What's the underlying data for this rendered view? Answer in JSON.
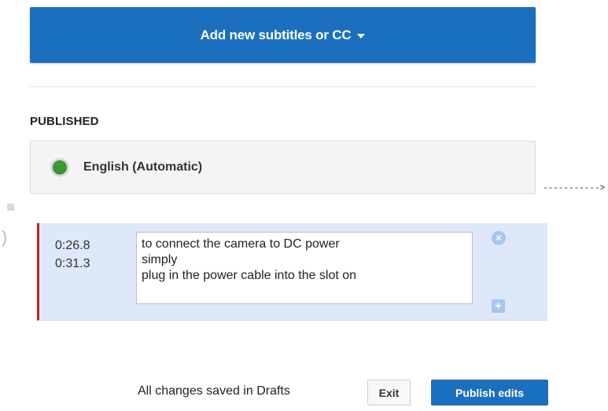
{
  "header": {
    "add_subtitles_label": "Add new subtitles or CC"
  },
  "published": {
    "section_title": "PUBLISHED",
    "language_label": "English (Automatic)",
    "status_color": "#3c9a32"
  },
  "annotation": {
    "arrow_text": "----------->"
  },
  "caption": {
    "start_time": "0:26.8",
    "end_time": "0:31.3",
    "text": "to connect the camera to DC power\nsimply\nplug in the power cable into the slot on",
    "remove_icon": "close-circle-icon",
    "add_icon": "plus-icon"
  },
  "footer": {
    "save_status": "All changes saved in Drafts",
    "exit_label": "Exit",
    "publish_label": "Publish edits"
  },
  "colors": {
    "accent": "#1b6fbf",
    "selected_row": "#dde9fa",
    "active_marker": "#cc1f1f"
  }
}
